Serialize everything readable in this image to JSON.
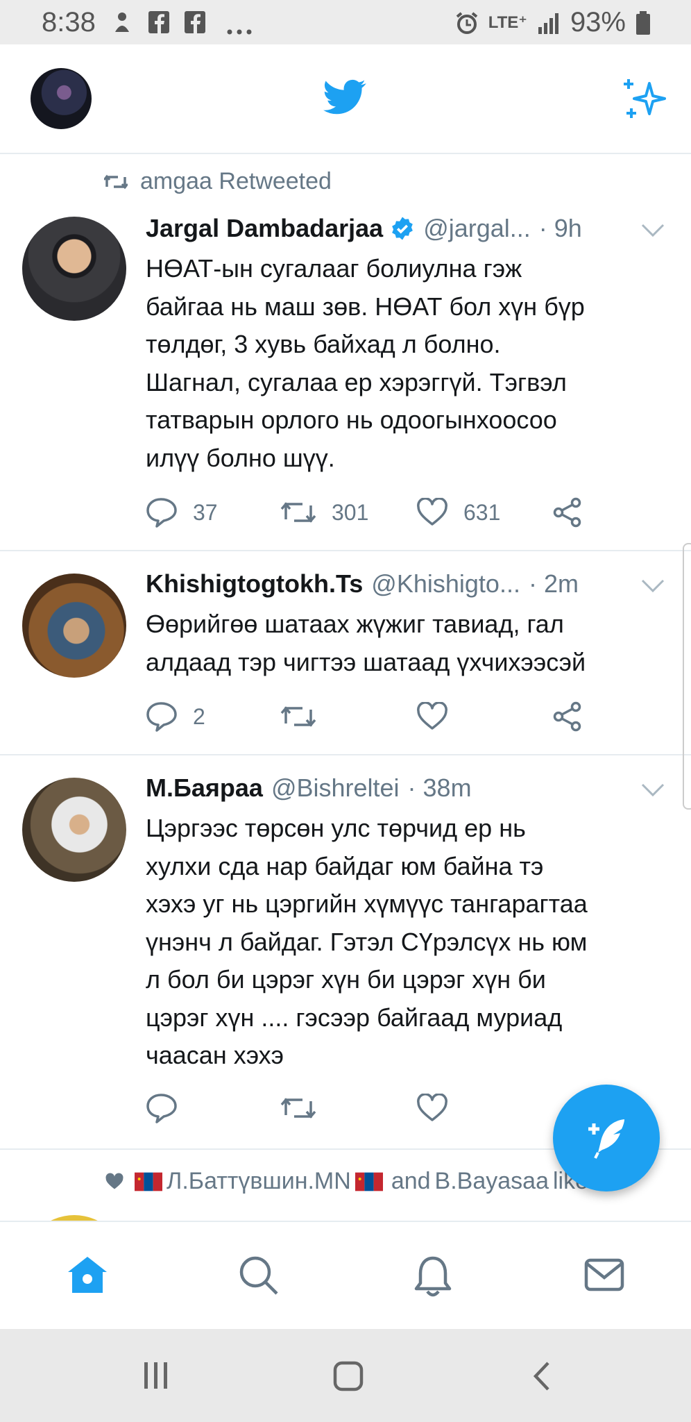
{
  "status_bar": {
    "time": "8:38",
    "network": "LTE⁺",
    "battery": "93%"
  },
  "header": {
    "logo_icon": "twitter-bird-icon",
    "sparkle_icon": "sparkle-icon"
  },
  "tweets": [
    {
      "social_context": "amgaa Retweeted",
      "name": "Jargal Dambadarjaa",
      "verified": true,
      "handle": "@jargal...",
      "time": "· 9h",
      "lines": [
        "НӨАТ-ын сугалааг болиулна гэж",
        "байгаа нь маш зөв. НӨАТ бол хүн бүр",
        "төлдөг, 3 хувь байхад л болно.",
        "Шагнал, сугалаа ер хэрэггүй. Тэгвэл",
        "татварын орлого нь одоогынхоосоо",
        "илүү болно шүү."
      ],
      "replies": "37",
      "retweets": "301",
      "likes": "631"
    },
    {
      "name": "Khishigtogtokh.Ts",
      "handle": "@Khishigto...",
      "time": "· 2m",
      "lines": [
        "Өөрийгөө шатаах жүжиг тавиад, гал",
        "алдаад тэр чигтээ шатаад үхчихээсэй"
      ],
      "replies": "2",
      "retweets": "",
      "likes": ""
    },
    {
      "name": "М.Баяраа",
      "handle": "@Bishreltei",
      "time": "· 38m",
      "lines": [
        "Цэргээс төрсөн улс төрчид ер нь",
        "хулхи сда нар байдаг юм байна тэ",
        "хэхэ уг нь цэргийн хүмүүс тангарагтаа",
        "үнэнч л байдаг. Гэтэл СҮрэлсүх нь юм",
        "л бол би цэрэг хүн би цэрэг хүн би",
        "цэрэг хүн .... гэсээр байгаад муриад",
        "чаасан хэхэ"
      ],
      "replies": "",
      "retweets": "",
      "likes": ""
    }
  ],
  "liked_context": {
    "user1": "Л.Баттүвшин.MN",
    "connector": "and",
    "user2": "B.Bayasaa",
    "suffix": "liked"
  },
  "colors": {
    "accent": "#1da1f2",
    "muted": "#657786",
    "text": "#14171a"
  }
}
